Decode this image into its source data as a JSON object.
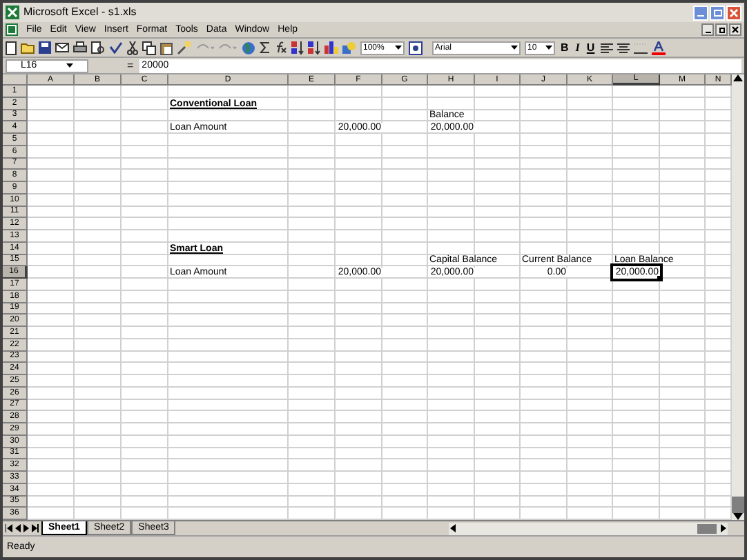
{
  "window": {
    "title": "Microsoft Excel - s1.xls"
  },
  "menu": [
    "File",
    "Edit",
    "View",
    "Insert",
    "Format",
    "Tools",
    "Data",
    "Window",
    "Help"
  ],
  "toolbar": {
    "zoom": "100%",
    "font": "Arial",
    "size": "10",
    "bold": "B",
    "italic": "I",
    "underline": "U"
  },
  "formula_bar": {
    "name_box": "L16",
    "equals": "=",
    "value": "20000"
  },
  "columns": [
    {
      "label": "A",
      "selected": false
    },
    {
      "label": "B",
      "selected": false
    },
    {
      "label": "C",
      "selected": false
    },
    {
      "label": "D",
      "selected": false
    },
    {
      "label": "E",
      "selected": false
    },
    {
      "label": "F",
      "selected": false
    },
    {
      "label": "G",
      "selected": false
    },
    {
      "label": "H",
      "selected": false
    },
    {
      "label": "I",
      "selected": false
    },
    {
      "label": "J",
      "selected": false
    },
    {
      "label": "K",
      "selected": false
    },
    {
      "label": "L",
      "selected": true
    },
    {
      "label": "M",
      "selected": false
    },
    {
      "label": "N",
      "selected": false
    }
  ],
  "rows": [
    {
      "label": "1",
      "selected": false
    },
    {
      "label": "2",
      "selected": false,
      "cells": {
        "D": {
          "text": "Conventional Loan",
          "kind": "heading",
          "selected": false
        }
      }
    },
    {
      "label": "3",
      "selected": false,
      "cells": {
        "H": {
          "text": "Balance",
          "kind": "text",
          "selected": false
        }
      }
    },
    {
      "label": "4",
      "selected": false,
      "cells": {
        "D": {
          "text": "Loan Amount",
          "kind": "text",
          "selected": false
        },
        "F": {
          "text": "20,000.00",
          "kind": "number",
          "selected": false
        },
        "H": {
          "text": "20,000.00",
          "kind": "number",
          "selected": false
        }
      }
    },
    {
      "label": "5",
      "selected": false
    },
    {
      "label": "6",
      "selected": false
    },
    {
      "label": "7",
      "selected": false
    },
    {
      "label": "8",
      "selected": false
    },
    {
      "label": "9",
      "selected": false
    },
    {
      "label": "10",
      "selected": false
    },
    {
      "label": "11",
      "selected": false
    },
    {
      "label": "12",
      "selected": false
    },
    {
      "label": "13",
      "selected": false
    },
    {
      "label": "14",
      "selected": false,
      "cells": {
        "D": {
          "text": "Smart Loan",
          "kind": "heading",
          "selected": false
        }
      }
    },
    {
      "label": "15",
      "selected": false,
      "cells": {
        "H": {
          "text": "Capital Balance",
          "kind": "text",
          "selected": false
        },
        "J": {
          "text": "Current Balance",
          "kind": "text",
          "selected": false
        },
        "L": {
          "text": "Loan Balance",
          "kind": "text",
          "selected": false
        }
      }
    },
    {
      "label": "16",
      "selected": true,
      "cells": {
        "D": {
          "text": "Loan Amount",
          "kind": "text",
          "selected": false
        },
        "F": {
          "text": "20,000.00",
          "kind": "number",
          "selected": false
        },
        "H": {
          "text": "20,000.00",
          "kind": "number",
          "selected": false
        },
        "J": {
          "text": "0.00",
          "kind": "number",
          "selected": false
        },
        "L": {
          "text": "20,000.00",
          "kind": "number",
          "selected": true
        }
      }
    },
    {
      "label": "17",
      "selected": false
    },
    {
      "label": "18",
      "selected": false
    },
    {
      "label": "19",
      "selected": false
    },
    {
      "label": "20",
      "selected": false
    },
    {
      "label": "21",
      "selected": false
    },
    {
      "label": "22",
      "selected": false
    },
    {
      "label": "23",
      "selected": false
    },
    {
      "label": "24",
      "selected": false
    },
    {
      "label": "25",
      "selected": false
    },
    {
      "label": "26",
      "selected": false
    },
    {
      "label": "27",
      "selected": false
    },
    {
      "label": "28",
      "selected": false
    },
    {
      "label": "29",
      "selected": false
    },
    {
      "label": "30",
      "selected": false
    },
    {
      "label": "31",
      "selected": false
    },
    {
      "label": "32",
      "selected": false
    },
    {
      "label": "33",
      "selected": false
    },
    {
      "label": "34",
      "selected": false
    },
    {
      "label": "35",
      "selected": false
    },
    {
      "label": "36",
      "selected": false
    }
  ],
  "sheet_tabs": [
    {
      "label": "Sheet1",
      "selected": true
    },
    {
      "label": "Sheet2",
      "selected": false
    },
    {
      "label": "Sheet3",
      "selected": false
    }
  ],
  "status_bar": {
    "text": "Ready"
  }
}
